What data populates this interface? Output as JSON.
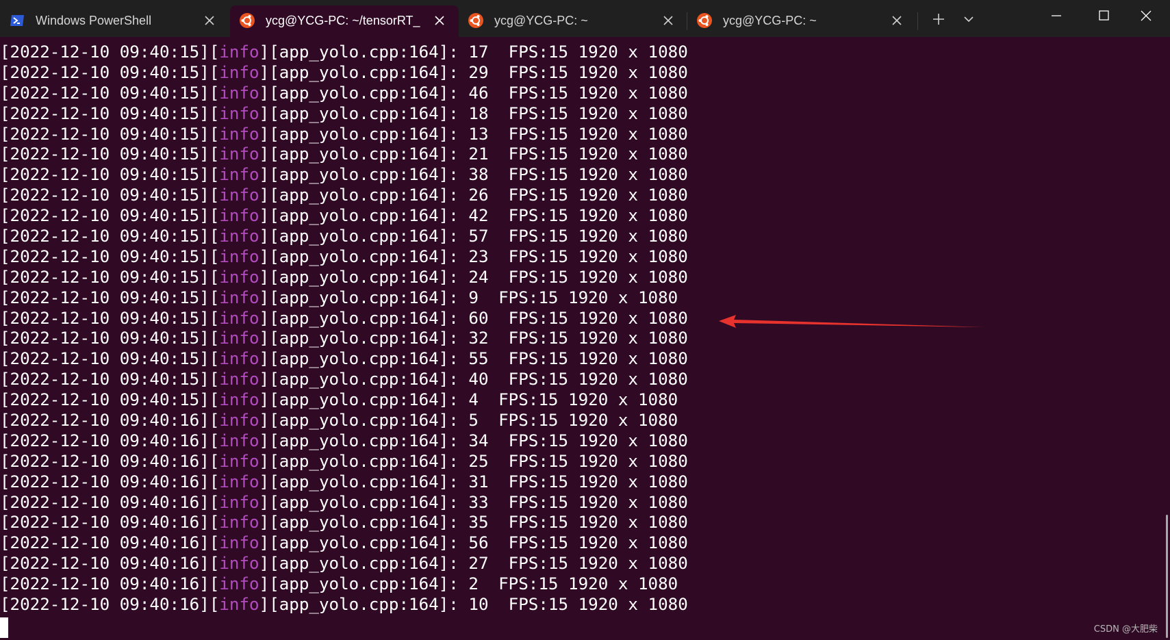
{
  "tabs": [
    {
      "label": "Windows PowerShell",
      "icon": "powershell-icon",
      "active": false
    },
    {
      "label": "ycg@YCG-PC: ~/tensorRT_",
      "icon": "ubuntu-icon",
      "active": true
    },
    {
      "label": "ycg@YCG-PC: ~",
      "icon": "ubuntu-icon",
      "active": false
    },
    {
      "label": "ycg@YCG-PC: ~",
      "icon": "ubuntu-icon",
      "active": false
    }
  ],
  "colors": {
    "terminal_bg": "#300a24",
    "tabbar_bg": "#202020",
    "info_color": "#b34cc0",
    "ubuntu_orange": "#e95420",
    "powershell_blue": "#2d5bd8",
    "arrow_red": "#e8322e"
  },
  "log": {
    "level": "info",
    "source": "[app_yolo.cpp:164]:",
    "lines": [
      {
        "ts": "[2022-12-10 09:40:15]",
        "msg": " 17  FPS:15 1920 x 1080"
      },
      {
        "ts": "[2022-12-10 09:40:15]",
        "msg": " 29  FPS:15 1920 x 1080"
      },
      {
        "ts": "[2022-12-10 09:40:15]",
        "msg": " 46  FPS:15 1920 x 1080"
      },
      {
        "ts": "[2022-12-10 09:40:15]",
        "msg": " 18  FPS:15 1920 x 1080"
      },
      {
        "ts": "[2022-12-10 09:40:15]",
        "msg": " 13  FPS:15 1920 x 1080"
      },
      {
        "ts": "[2022-12-10 09:40:15]",
        "msg": " 21  FPS:15 1920 x 1080"
      },
      {
        "ts": "[2022-12-10 09:40:15]",
        "msg": " 38  FPS:15 1920 x 1080"
      },
      {
        "ts": "[2022-12-10 09:40:15]",
        "msg": " 26  FPS:15 1920 x 1080"
      },
      {
        "ts": "[2022-12-10 09:40:15]",
        "msg": " 42  FPS:15 1920 x 1080"
      },
      {
        "ts": "[2022-12-10 09:40:15]",
        "msg": " 57  FPS:15 1920 x 1080"
      },
      {
        "ts": "[2022-12-10 09:40:15]",
        "msg": " 23  FPS:15 1920 x 1080"
      },
      {
        "ts": "[2022-12-10 09:40:15]",
        "msg": " 24  FPS:15 1920 x 1080"
      },
      {
        "ts": "[2022-12-10 09:40:15]",
        "msg": " 9  FPS:15 1920 x 1080"
      },
      {
        "ts": "[2022-12-10 09:40:15]",
        "msg": " 60  FPS:15 1920 x 1080"
      },
      {
        "ts": "[2022-12-10 09:40:15]",
        "msg": " 32  FPS:15 1920 x 1080"
      },
      {
        "ts": "[2022-12-10 09:40:15]",
        "msg": " 55  FPS:15 1920 x 1080"
      },
      {
        "ts": "[2022-12-10 09:40:15]",
        "msg": " 40  FPS:15 1920 x 1080"
      },
      {
        "ts": "[2022-12-10 09:40:15]",
        "msg": " 4  FPS:15 1920 x 1080"
      },
      {
        "ts": "[2022-12-10 09:40:16]",
        "msg": " 5  FPS:15 1920 x 1080"
      },
      {
        "ts": "[2022-12-10 09:40:16]",
        "msg": " 34  FPS:15 1920 x 1080"
      },
      {
        "ts": "[2022-12-10 09:40:16]",
        "msg": " 25  FPS:15 1920 x 1080"
      },
      {
        "ts": "[2022-12-10 09:40:16]",
        "msg": " 31  FPS:15 1920 x 1080"
      },
      {
        "ts": "[2022-12-10 09:40:16]",
        "msg": " 33  FPS:15 1920 x 1080"
      },
      {
        "ts": "[2022-12-10 09:40:16]",
        "msg": " 35  FPS:15 1920 x 1080"
      },
      {
        "ts": "[2022-12-10 09:40:16]",
        "msg": " 56  FPS:15 1920 x 1080"
      },
      {
        "ts": "[2022-12-10 09:40:16]",
        "msg": " 27  FPS:15 1920 x 1080"
      },
      {
        "ts": "[2022-12-10 09:40:16]",
        "msg": " 2  FPS:15 1920 x 1080"
      },
      {
        "ts": "[2022-12-10 09:40:16]",
        "msg": " 10  FPS:15 1920 x 1080"
      }
    ]
  },
  "annotation": {
    "type": "red-arrow",
    "points_to_line": 13
  },
  "watermark": "CSDN @大肥柴"
}
